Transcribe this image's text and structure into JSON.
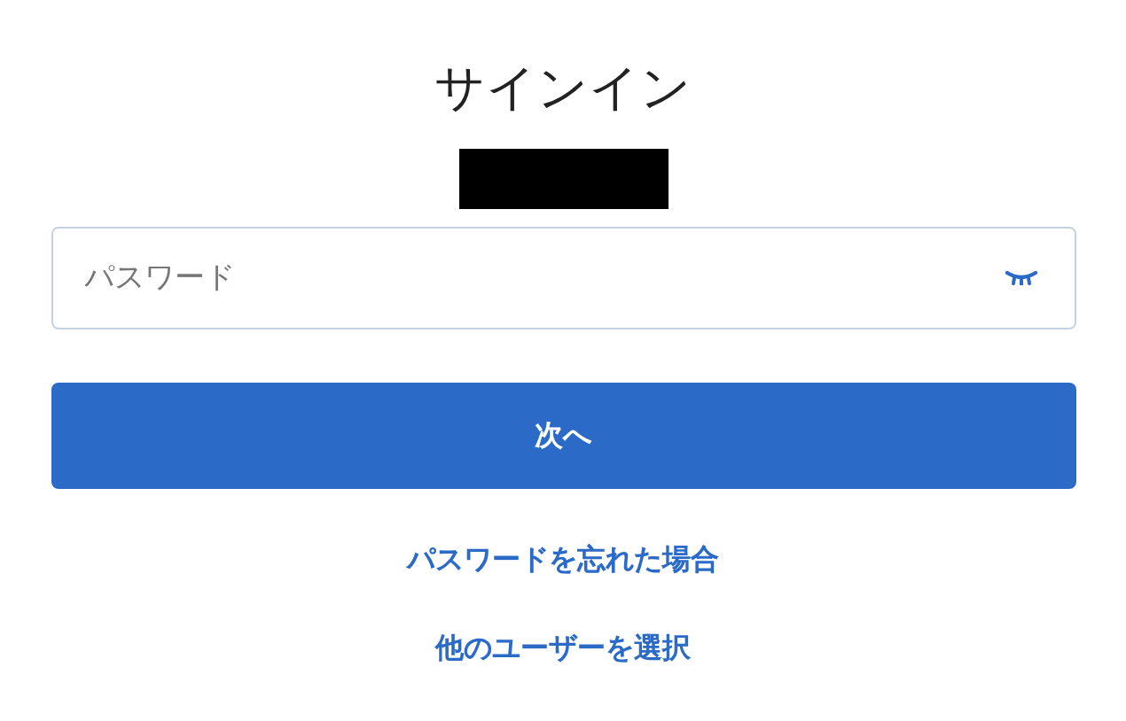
{
  "title": "サインイン",
  "password_field": {
    "placeholder": "パスワード"
  },
  "next_button": {
    "label": "次へ"
  },
  "links": [
    {
      "label": "パスワードを忘れた場合"
    },
    {
      "label": "他のユーザーを選択"
    }
  ]
}
